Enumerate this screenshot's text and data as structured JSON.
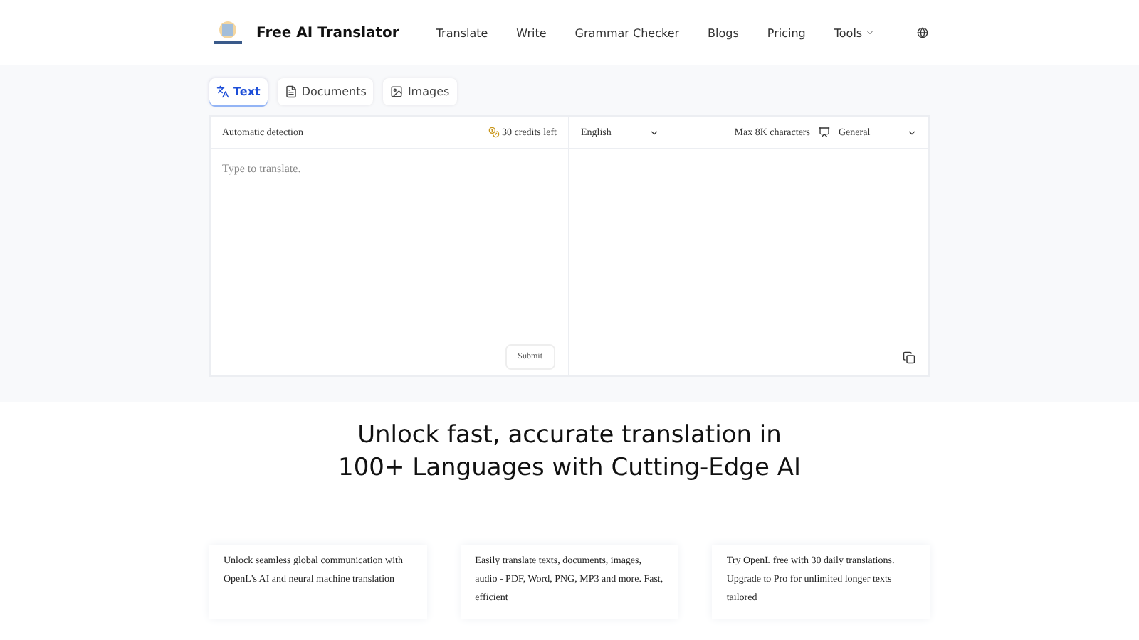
{
  "header": {
    "brand": "Free AI Translator",
    "nav": [
      {
        "label": "Translate",
        "dropdown": false
      },
      {
        "label": "Write",
        "dropdown": false
      },
      {
        "label": "Grammar Checker",
        "dropdown": false
      },
      {
        "label": "Blogs",
        "dropdown": false
      },
      {
        "label": "Pricing",
        "dropdown": false
      },
      {
        "label": "Tools",
        "dropdown": true
      }
    ]
  },
  "tabs": [
    {
      "label": "Text",
      "kind": "text",
      "selected": true
    },
    {
      "label": "Documents",
      "kind": "document",
      "selected": false
    },
    {
      "label": "Images",
      "kind": "image",
      "selected": false
    }
  ],
  "source": {
    "language": "Automatic detection",
    "credits": "30 credits left",
    "placeholder": "Type to translate.",
    "submit": "Submit"
  },
  "target": {
    "language": "English",
    "limit": "Max 8K characters",
    "mode": "General"
  },
  "hero": {
    "title": "Unlock fast, accurate translation in 100+ Languages with Cutting-Edge AI"
  },
  "cards": [
    {
      "text": "Unlock seamless global communication with OpenL's AI and neural machine translation"
    },
    {
      "text": "Easily translate texts, documents, images, audio - PDF, Word, PNG, MP3 and more. Fast, efficient"
    },
    {
      "text": "Try OpenL free with 30 daily translations. Upgrade to Pro for unlimited longer texts tailored"
    }
  ]
}
